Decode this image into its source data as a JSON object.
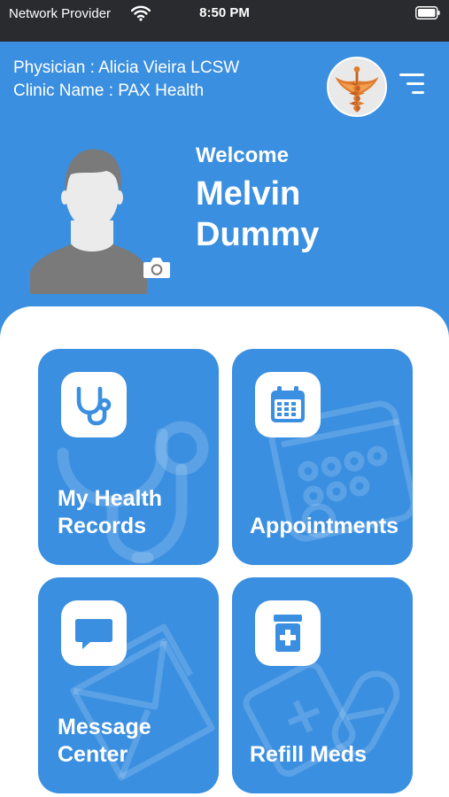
{
  "status_bar": {
    "carrier": "Network Provider",
    "time": "8:50 PM"
  },
  "header": {
    "physician_line": "Physician : Alicia Vieira LCSW",
    "clinic_line": "Clinic Name : PAX Health"
  },
  "welcome": {
    "label": "Welcome",
    "first_name": "Melvin",
    "last_name": "Dummy"
  },
  "tiles": [
    {
      "label_line1": "My Health",
      "label_line2": "Records"
    },
    {
      "label_line1": "",
      "label_line2": "Appointments"
    },
    {
      "label_line1": "Message",
      "label_line2": "Center"
    },
    {
      "label_line1": "",
      "label_line2": "Refill Meds"
    }
  ],
  "colors": {
    "primary": "#3b8fe0",
    "status_bar": "#2a2b2f",
    "background": "#ffffff"
  }
}
